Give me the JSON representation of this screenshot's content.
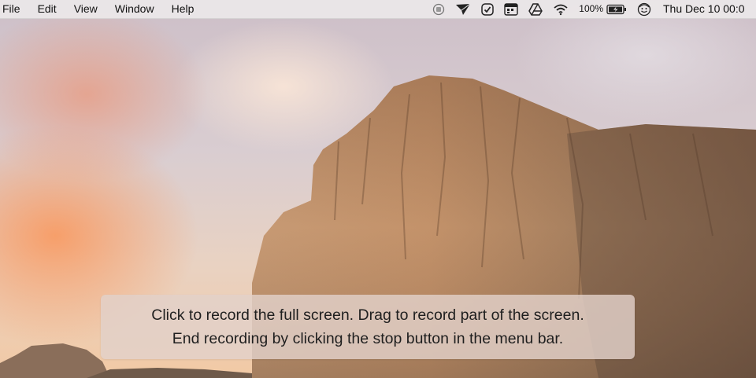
{
  "menubar": {
    "menus": [
      "File",
      "Edit",
      "View",
      "Window",
      "Help"
    ],
    "status_icons": [
      "record-stop-icon",
      "paper-plane-icon",
      "checkmark-badge-icon",
      "calendar-badge-icon",
      "google-drive-icon",
      "wifi-icon"
    ],
    "battery_percent": "100%",
    "battery_icon": "battery-charging-icon",
    "user_icon": "user-face-icon",
    "clock": "Thu Dec 10  00:0"
  },
  "overlay": {
    "line1": "Click to record the full screen. Drag to record part of the screen.",
    "line2": "End recording by clicking the stop button in the menu bar."
  },
  "colors": {
    "menubar_bg": "#ece8e9",
    "overlay_bg": "#e2d1c9",
    "rock": "#b88a66"
  }
}
